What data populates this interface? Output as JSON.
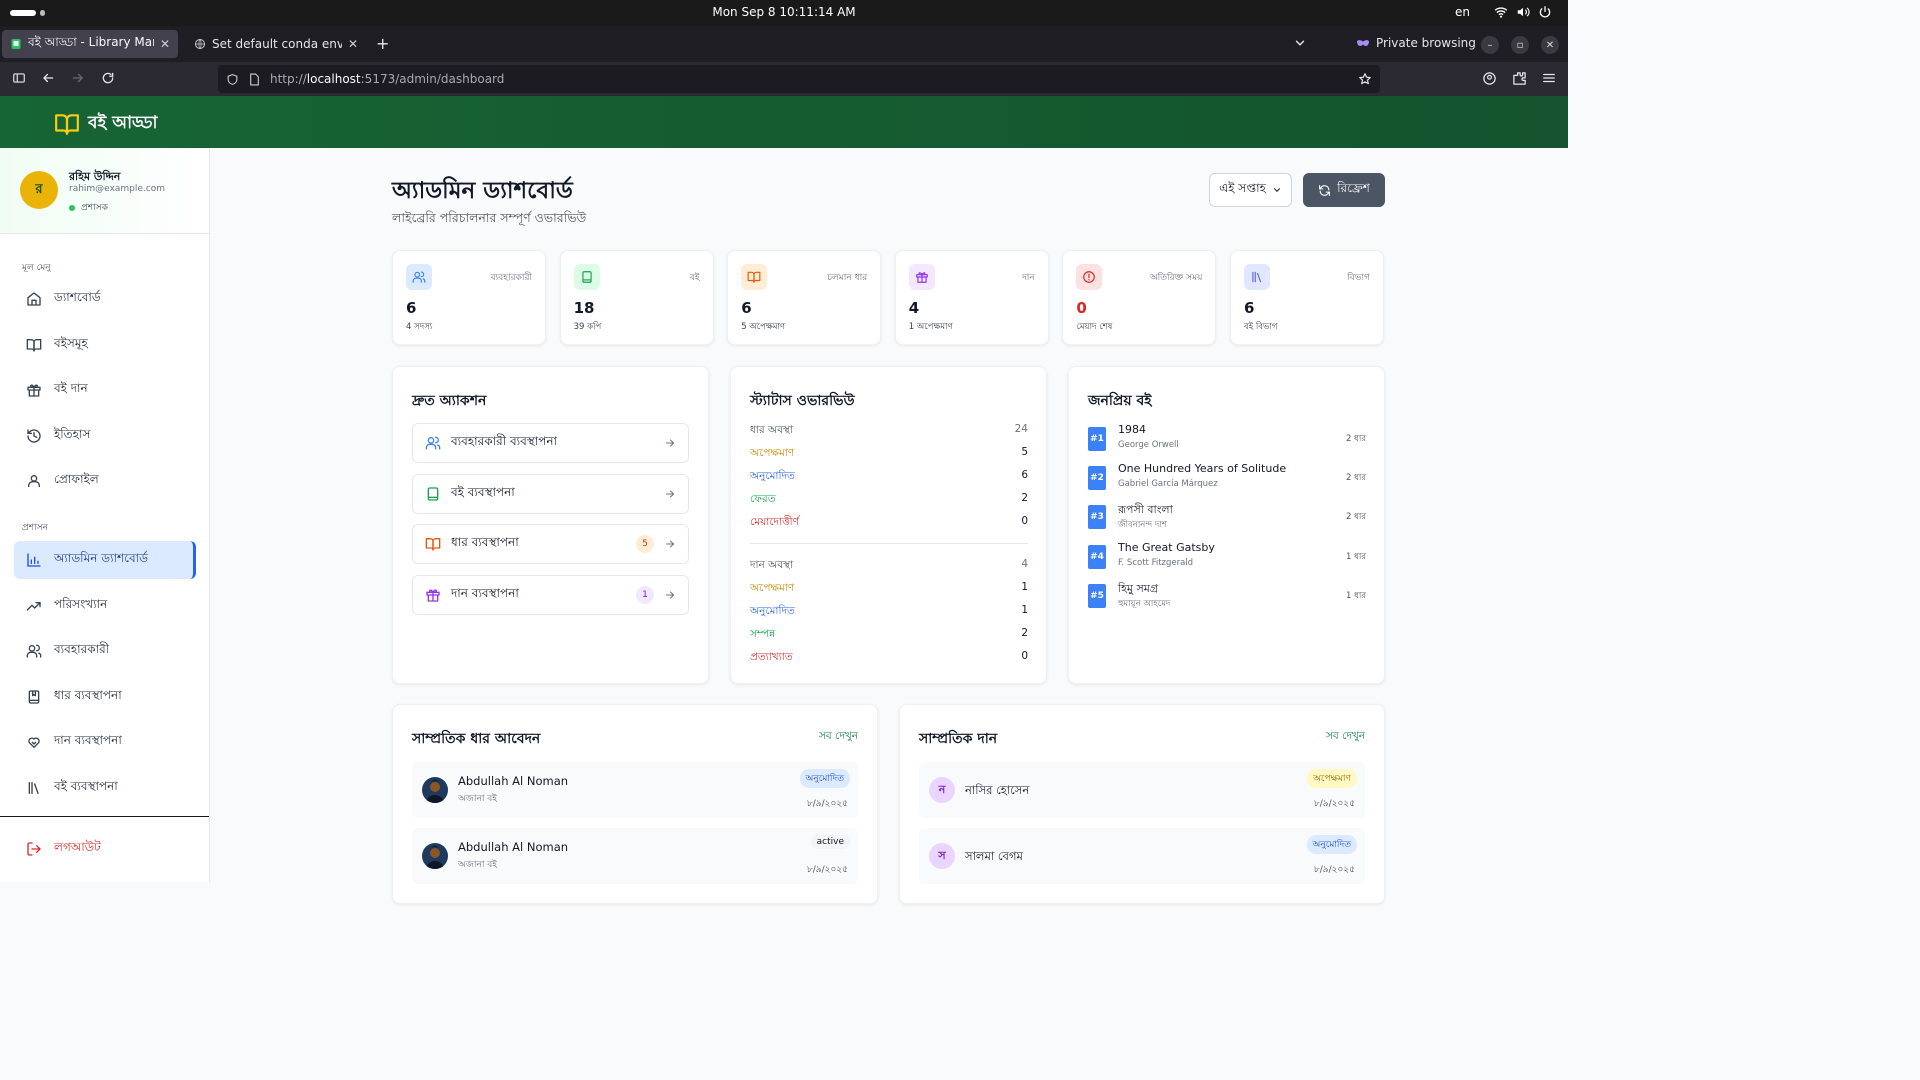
{
  "os": {
    "clock": "Mon Sep 8  10:11:14 AM",
    "lang": "en"
  },
  "browser": {
    "tabs": [
      {
        "title": "বই আড্ডা - Library Manager"
      },
      {
        "title": "Set default conda env"
      }
    ],
    "private_label": "Private browsing",
    "url_scheme": "http://",
    "url_host": "localhost",
    "url_rest": ":5173/admin/dashboard"
  },
  "app": {
    "name": "বই আড্ডা"
  },
  "user": {
    "initial": "র",
    "name": "রহিম উদ্দিন",
    "email": "rahim@example.com",
    "role": "প্রশাসক"
  },
  "sidebar": {
    "main_heading": "মূল মেনু",
    "main_items": [
      {
        "label": "ড্যাশবোর্ড",
        "icon": "home-icon"
      },
      {
        "label": "বইসমূহ",
        "icon": "book-open-icon"
      },
      {
        "label": "বই দান",
        "icon": "gift-icon"
      },
      {
        "label": "ইতিহাস",
        "icon": "history-icon"
      },
      {
        "label": "প্রোফাইল",
        "icon": "user-icon"
      }
    ],
    "admin_heading": "প্রশাসন",
    "admin_items": [
      {
        "label": "অ্যাডমিন ড্যাশবোর্ড",
        "icon": "bar-chart-icon",
        "active": true
      },
      {
        "label": "পরিসংখ্যান",
        "icon": "trending-up-icon"
      },
      {
        "label": "ব্যবহারকারী",
        "icon": "users-icon"
      },
      {
        "label": "ধার ব্যবস্থাপনা",
        "icon": "book-marked-icon"
      },
      {
        "label": "দান ব্যবস্থাপনা",
        "icon": "hand-heart-icon"
      },
      {
        "label": "বই ব্যবস্থাপনা",
        "icon": "library-icon"
      }
    ],
    "logout": "লগআউট"
  },
  "page": {
    "title": "অ্যাডমিন ড্যাশবোর্ড",
    "subtitle": "লাইব্রেরি পরিচালনার সম্পূর্ণ ওভারভিউ",
    "period": "এই সপ্তাহ",
    "refresh": "রিফ্রেশ"
  },
  "stats": [
    {
      "label": "ব্যবহারকারী",
      "value": "6",
      "sub": "4 সদস্য",
      "color": "#3b82f6",
      "bg": "#dbeafe",
      "icon": "users-icon"
    },
    {
      "label": "বই",
      "value": "18",
      "sub": "39 কপি",
      "color": "#16a34a",
      "bg": "#dcfce7",
      "icon": "book-icon"
    },
    {
      "label": "চলমান ধার",
      "value": "6",
      "sub": "5 অপেক্ষমাণ",
      "color": "#ea580c",
      "bg": "#ffedd5",
      "icon": "book-open-icon"
    },
    {
      "label": "দান",
      "value": "4",
      "sub": "1 অপেক্ষমাণ",
      "color": "#9333ea",
      "bg": "#f3e8ff",
      "icon": "gift-icon"
    },
    {
      "label": "অতিরিক্ত সময়",
      "value": "0",
      "sub": "মেয়াদ শেষ",
      "color": "#dc2626",
      "bg": "#fee2e2",
      "icon": "alert-circle-icon"
    },
    {
      "label": "বিভাগ",
      "value": "6",
      "sub": "বই বিভাগ",
      "color": "#6366f1",
      "bg": "#e0e7ff",
      "icon": "library-icon"
    }
  ],
  "quick": {
    "title": "দ্রুত অ্যাকশন",
    "items": [
      {
        "label": "ব্যবহারকারী ব্যবস্থাপনা",
        "icon": "users-icon",
        "color": "#3b82f6",
        "badge": ""
      },
      {
        "label": "বই ব্যবস্থাপনা",
        "icon": "book-icon",
        "color": "#16a34a",
        "badge": ""
      },
      {
        "label": "ধার ব্যবস্থাপনা",
        "icon": "book-open-icon",
        "color": "#ea580c",
        "badge": "5",
        "badge_bg": "#ffedd5",
        "badge_fg": "#c2410c"
      },
      {
        "label": "দান ব্যবস্থাপনা",
        "icon": "gift-icon",
        "color": "#9333ea",
        "badge": "1",
        "badge_bg": "#f3e8ff",
        "badge_fg": "#7e22ce"
      }
    ]
  },
  "status": {
    "title": "স্ট্যাটাস ওভারভিউ",
    "borrow": {
      "head": "ধার অবস্থা",
      "total": "24",
      "rows": [
        {
          "label": "অপেক্ষমাণ",
          "value": "5",
          "color": "#ca8a04"
        },
        {
          "label": "অনুমোদিত",
          "value": "6",
          "color": "#2563eb"
        },
        {
          "label": "ফেরত",
          "value": "2",
          "color": "#16a34a"
        },
        {
          "label": "মেয়াদোত্তীর্ণ",
          "value": "0",
          "color": "#dc2626"
        }
      ]
    },
    "donation": {
      "head": "দান অবস্থা",
      "total": "4",
      "rows": [
        {
          "label": "অপেক্ষমাণ",
          "value": "1",
          "color": "#ca8a04"
        },
        {
          "label": "অনুমোদিত",
          "value": "1",
          "color": "#2563eb"
        },
        {
          "label": "সম্পন্ন",
          "value": "2",
          "color": "#16a34a"
        },
        {
          "label": "প্রত্যাখ্যাত",
          "value": "0",
          "color": "#dc2626"
        }
      ]
    }
  },
  "popular": {
    "title": "জনপ্রিয় বই",
    "items": [
      {
        "rank": "#1",
        "title": "1984",
        "author": "George Orwell",
        "count": "2 ধার"
      },
      {
        "rank": "#2",
        "title": "One Hundred Years of Solitude",
        "author": "Gabriel García Márquez",
        "count": "2 ধার"
      },
      {
        "rank": "#3",
        "title": "রূপসী বাংলা",
        "author": "জীবনানন্দ দাশ",
        "count": "2 ধার"
      },
      {
        "rank": "#4",
        "title": "The Great Gatsby",
        "author": "F. Scott Fitzgerald",
        "count": "1 ধার"
      },
      {
        "rank": "#5",
        "title": "হিমু সমগ্র",
        "author": "হুমায়ূন আহমেদ",
        "count": "1 ধার"
      }
    ]
  },
  "recent_borrows": {
    "title": "সাম্প্রতিক ধার আবেদন",
    "see_all": "সব দেখুন",
    "items": [
      {
        "name": "Abdullah Al Noman",
        "book": "অজানা বই",
        "status": "অনুমোদিত",
        "status_bg": "#dbeafe",
        "status_fg": "#1d4ed8",
        "date": "৮/৯/২০২৫"
      },
      {
        "name": "Abdullah Al Noman",
        "book": "অজানা বই",
        "status": "active",
        "status_bg": "#f3f4f6",
        "status_fg": "#111827",
        "date": "৮/৯/২০২৫"
      }
    ]
  },
  "recent_donations": {
    "title": "সাম্প্রতিক দান",
    "see_all": "সব দেখুন",
    "items": [
      {
        "initial": "ন",
        "name": "নাসির হোসেন",
        "status": "অপেক্ষমাণ",
        "status_bg": "#fef9c3",
        "status_fg": "#a16207",
        "date": "৮/৯/২০২৫"
      },
      {
        "initial": "স",
        "name": "সালমা বেগম",
        "status": "অনুমোদিত",
        "status_bg": "#dbeafe",
        "status_fg": "#1d4ed8",
        "date": "৮/৯/২০২৫"
      }
    ]
  }
}
